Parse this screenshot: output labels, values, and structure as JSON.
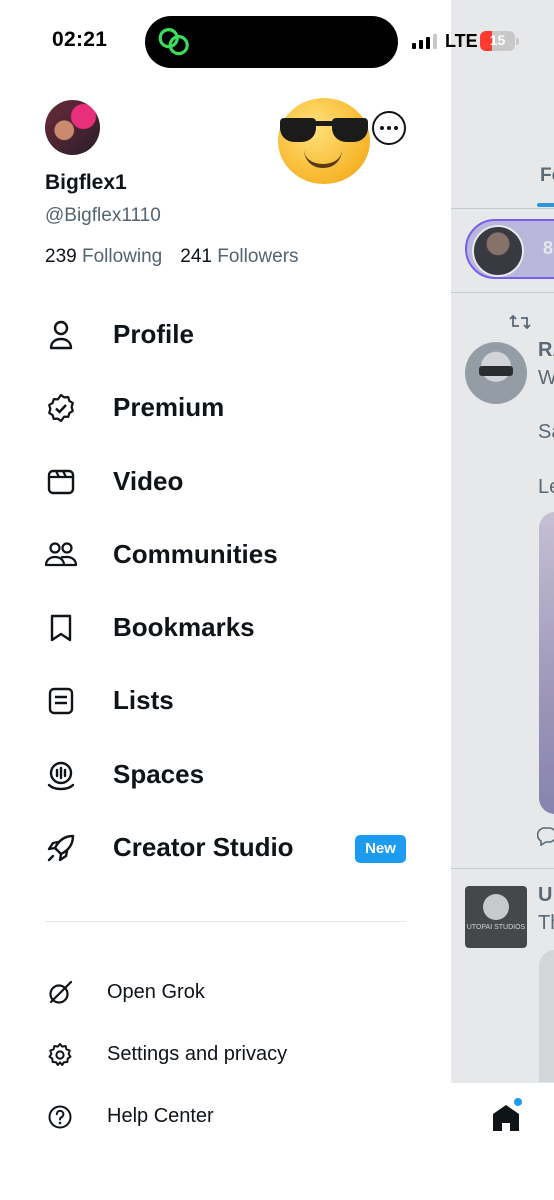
{
  "status_bar": {
    "time": "02:21",
    "network": "LTE",
    "battery_level": "15",
    "battery_fraction": 0.15
  },
  "profile": {
    "display_name": "Bigflex1",
    "handle": "@Bigflex1110",
    "following_count": "239",
    "following_label": "Following",
    "followers_count": "241",
    "followers_label": "Followers"
  },
  "menu": {
    "items": [
      {
        "label": "Profile",
        "icon": "person-icon"
      },
      {
        "label": "Premium",
        "icon": "verified-badge-icon"
      },
      {
        "label": "Video",
        "icon": "video-icon"
      },
      {
        "label": "Communities",
        "icon": "communities-icon"
      },
      {
        "label": "Bookmarks",
        "icon": "bookmark-icon"
      },
      {
        "label": "Lists",
        "icon": "lists-icon"
      },
      {
        "label": "Spaces",
        "icon": "spaces-icon"
      },
      {
        "label": "Creator Studio",
        "icon": "rocket-icon",
        "badge": "New"
      }
    ],
    "secondary": [
      {
        "label": "Open Grok",
        "icon": "grok-icon"
      },
      {
        "label": "Settings and privacy",
        "icon": "gear-icon"
      },
      {
        "label": "Help Center",
        "icon": "help-icon"
      }
    ]
  },
  "feed": {
    "tab_label": "Fo",
    "space_count": "8",
    "post1_name": "RA",
    "post1_line1": "W",
    "post1_line2": "Sa",
    "post1_line3": "Le",
    "post2_name": "U",
    "post2_line1": "Th",
    "post2_avatar_text": "UTOPAI STUDIOS"
  },
  "colors": {
    "accent": "#1d9bf0",
    "text_primary": "#0f1419",
    "text_secondary": "#536471",
    "battery_low": "#ff3b30"
  }
}
